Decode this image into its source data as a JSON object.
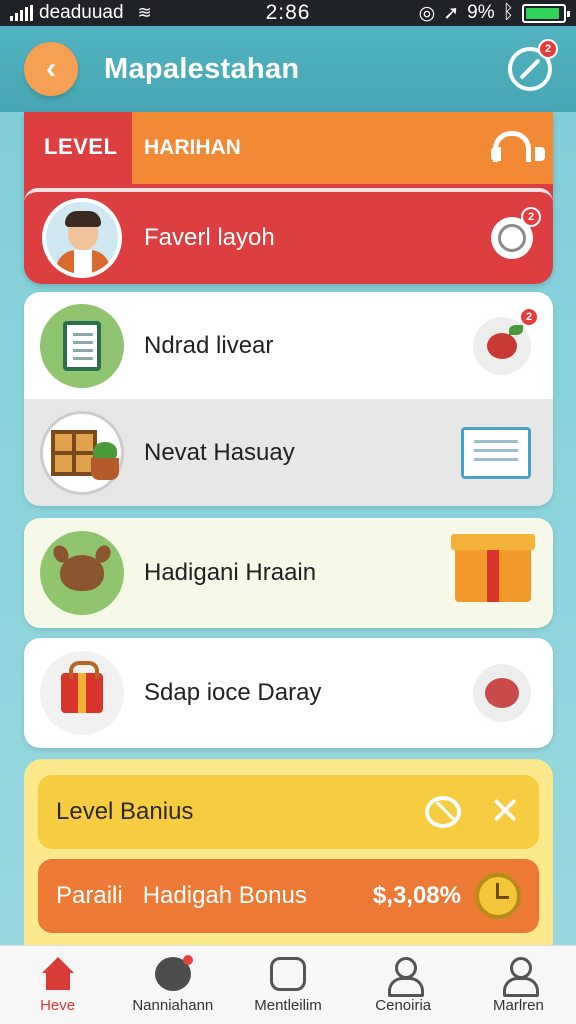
{
  "status_bar": {
    "carrier": "deaduuad",
    "time": "2:86",
    "battery": "9%"
  },
  "header": {
    "title": "Mapalestahan",
    "notif_count": "2"
  },
  "level_card": {
    "tab_label": "LEVEL",
    "banner_label": "HARIHAN",
    "user_name": "Faverl layoh",
    "notif_count": "2"
  },
  "list": {
    "items": [
      {
        "label": "Ndrad livear",
        "badge": "2",
        "icon": "document-icon",
        "side_icon": "berries-icon"
      },
      {
        "label": "Nevat Hasuay",
        "icon": "shelf-plant-icon",
        "side_icon": "basket-icon"
      }
    ]
  },
  "cards": [
    {
      "label": "Hadigani Hraain",
      "icon": "deer-icon",
      "side_icon": "gift-box-icon"
    },
    {
      "label": "Sdap ioce Daray",
      "icon": "red-gift-icon",
      "side_icon": "peach-icon"
    }
  ],
  "bonus": {
    "level_label": "Level Banius",
    "row2_prefix": "Paraili",
    "row2_label": "Hadigah Bonus",
    "row2_amount": "$,3,08%"
  },
  "bottom_nav": [
    {
      "label": "Heve",
      "icon": "home-icon"
    },
    {
      "label": "Nanniahann",
      "icon": "map-icon"
    },
    {
      "label": "Mentleilim",
      "icon": "chart-icon"
    },
    {
      "label": "Cenoiria",
      "icon": "user-icon"
    },
    {
      "label": "Marlren",
      "icon": "profile-icon"
    }
  ],
  "colors": {
    "accent_red": "#dd3e40",
    "accent_orange": "#f28a35",
    "header_teal": "#50b3bf",
    "bonus_yellow": "#f7d04a"
  }
}
